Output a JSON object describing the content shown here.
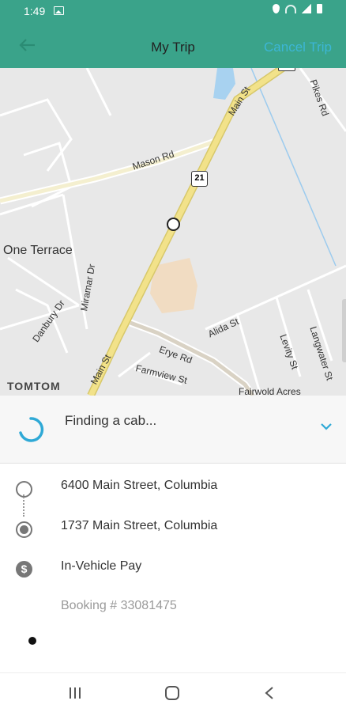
{
  "status_bar": {
    "time": "1:49"
  },
  "app_bar": {
    "title": "My Trip",
    "cancel_label": "Cancel Trip"
  },
  "map": {
    "place_label": "One Terrace",
    "attribution": "TOMTOM",
    "route_shield": "21",
    "roads": {
      "main_st_top": "Main St",
      "main_st_bottom": "Main St",
      "mason_rd": "Mason Rd",
      "miramar_dr": "Miramar Dr",
      "danbury_dr": "Danbury Dr",
      "alida_st": "Alida St",
      "levity_st": "Levity St",
      "langwater_st": "Langwater St",
      "erye_rd": "Erye Rd",
      "farmview_st": "Farmview St",
      "fairwold_acres": "Fairwold Acres",
      "pikes_rd": "Pikes Rd"
    }
  },
  "trip_status": {
    "text": "Finding a cab..."
  },
  "trip": {
    "pickup": "6400 Main Street, Columbia",
    "dropoff": "1737 Main Street, Columbia",
    "payment": "In-Vehicle Pay",
    "booking": "Booking # 33081475"
  },
  "colors": {
    "header": "#3aa38a",
    "accent": "#3cb6d6",
    "road_major": "#f2e28a"
  }
}
